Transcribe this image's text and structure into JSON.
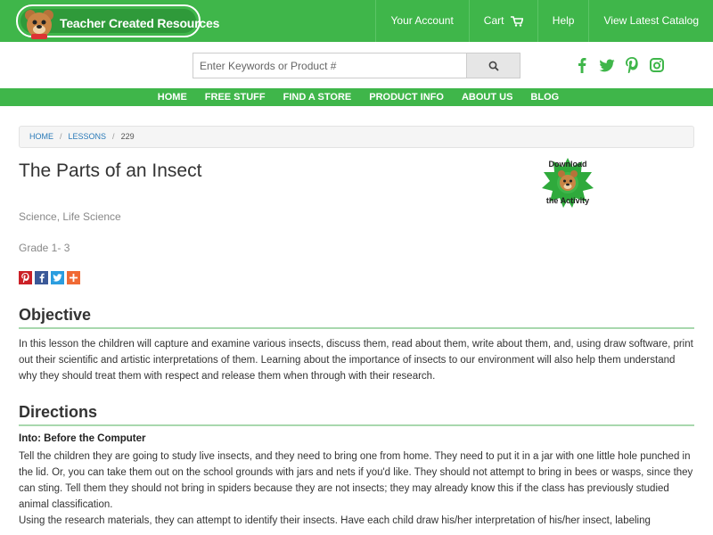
{
  "header": {
    "logo_text": "Teacher Created Resources",
    "nav": [
      {
        "label": "Your Account"
      },
      {
        "label": "Cart"
      },
      {
        "label": "Help"
      },
      {
        "label": "View Latest Catalog"
      }
    ]
  },
  "search": {
    "placeholder": "Enter Keywords or Product #",
    "value": ""
  },
  "social": [
    "facebook-icon",
    "twitter-icon",
    "pinterest-icon",
    "instagram-icon"
  ],
  "main_nav": [
    "HOME",
    "FREE STUFF",
    "FIND A STORE",
    "PRODUCT INFO",
    "ABOUT US",
    "BLOG"
  ],
  "breadcrumb": {
    "items": [
      "HOME",
      "LESSONS"
    ],
    "current": "229"
  },
  "lesson": {
    "title": "The Parts of an Insect",
    "subject": "Science, Life Science",
    "grade": "Grade 1- 3",
    "download_line1": "Download",
    "download_line2": "the Activity"
  },
  "share_buttons": [
    "pinterest",
    "facebook",
    "twitter",
    "plus"
  ],
  "objective": {
    "heading": "Objective",
    "text": "In this lesson the children will capture and examine various insects, discuss them, read about them, write about them, and, using draw software, print out their scientific and artistic interpretations of them. Learning about the importance of insects to our environment will also help them understand why they should treat them with respect and release them when through with their research."
  },
  "directions": {
    "heading": "Directions",
    "subheading": "Into: Before the Computer",
    "para1": "Tell the children they are going to study live insects, and they need to bring one from home. They need to put it in a jar with one little hole punched in the lid. Or, you can take them out on the school grounds with jars and nets if you'd like. They should not attempt to bring in bees or wasps, since they can sting. Tell them they should not bring in spiders because they are not insects; they may already know this if the class has previously studied animal classification.",
    "para2": "Using the research materials, they can attempt to identify their insects. Have each child draw his/her interpretation of his/her insect, labeling"
  },
  "colors": {
    "brand_green": "#3fb64a",
    "link_blue": "#2a7ab8",
    "rule_green": "#a8d8ae"
  }
}
